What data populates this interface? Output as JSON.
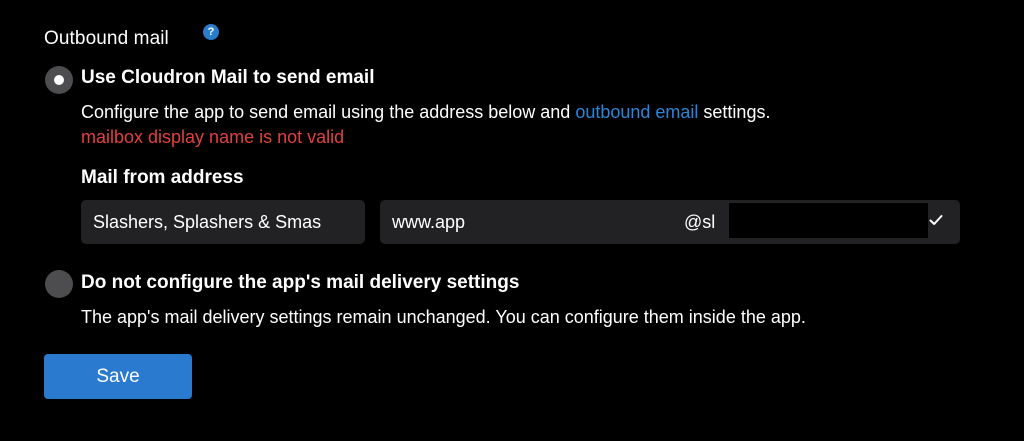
{
  "section": {
    "title": "Outbound mail",
    "help_icon": "?"
  },
  "option_cloudron": {
    "label": "Use Cloudron Mail to send email",
    "selected": true,
    "description_prefix": "Configure the app to send email using the address below and ",
    "description_link": "outbound email",
    "description_suffix": " settings.",
    "error": "mailbox display name is not valid",
    "field_label": "Mail from address",
    "display_name_value": "Slashers, Splashers & Smas",
    "mailbox_value": "www.app",
    "domain_prefix": "@sl"
  },
  "option_none": {
    "label": "Do not configure the app's mail delivery settings",
    "selected": false,
    "description": "The app's mail delivery settings remain unchanged. You can configure them inside the app."
  },
  "save_button": {
    "label": "Save"
  },
  "colors": {
    "background": "#000000",
    "accent": "#2a7bd0",
    "link": "#2a86d8",
    "error": "#e0413c",
    "input_background": "#222225",
    "radio_background": "#4d4d50"
  },
  "icons": {
    "help": "question-circle-icon",
    "confirm": "checkmark-icon"
  }
}
